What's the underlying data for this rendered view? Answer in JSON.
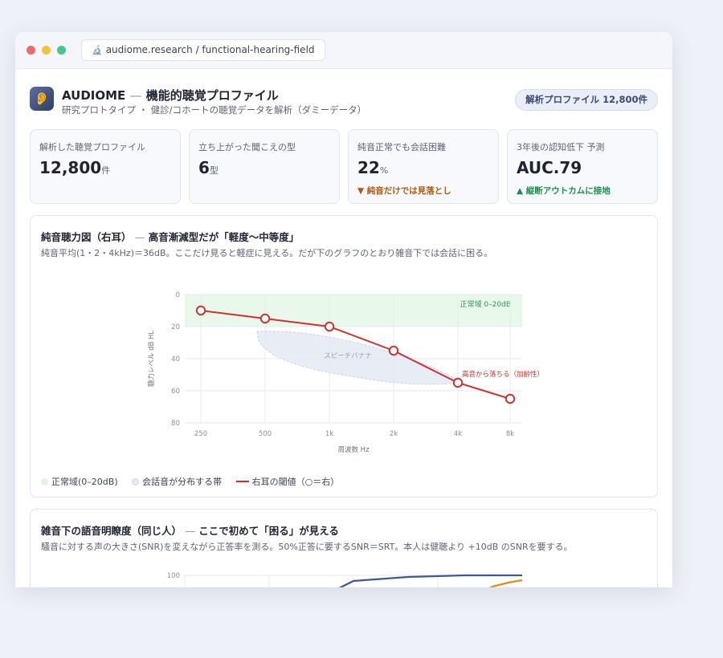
{
  "browser": {
    "url": "audiome.research / functional-hearing-field",
    "url_icon": "microscope-icon"
  },
  "app": {
    "logo_icon": "ear-icon",
    "name": "AUDIOME",
    "title_sep": "—",
    "title": "機能的聴覚プロファイル",
    "subtitle": "研究プロトタイプ ・ 健診/コホートの聴覚データを解析（ダミーデータ）",
    "profile_pill": "解析プロファイル 12,800件"
  },
  "kpis": [
    {
      "label": "解析した聴覚プロファイル",
      "value": "12,800",
      "unit": "件",
      "note": "",
      "note_tone": ""
    },
    {
      "label": "立ち上がった聞こえの型",
      "value": "6",
      "unit": "型",
      "note": "",
      "note_tone": ""
    },
    {
      "label": "純音正常でも会話困難",
      "value": "22",
      "unit": "%",
      "note": "▼ 純音だけでは見落とし",
      "note_tone": "warn"
    },
    {
      "label": "3年後の認知低下 予測",
      "value": "AUC.79",
      "unit": "",
      "note": "▲ 縦断アウトカムに接地",
      "note_tone": "good"
    }
  ],
  "panel1": {
    "title_main": "純音聴力図（右耳）",
    "title_sep": "—",
    "title_rest": "高音漸減型だが「軽度〜中等度」",
    "subtitle": "純音平均(1・2・4kHz)＝36dB。ここだけ見ると軽症に見える。だが下のグラフのとおり雑音下では会話に困る。",
    "legend": [
      {
        "label": "正常域(0–20dB)",
        "kind": "dot",
        "color": "#dff6e6"
      },
      {
        "label": "会話音が分布する帯",
        "kind": "dot",
        "color": "#e6eaf3"
      },
      {
        "label": "右耳の閾値（○＝右）",
        "kind": "line",
        "color": "#d0312d"
      }
    ]
  },
  "panel2": {
    "title_main": "雑音下の語音明瞭度（同じ人）",
    "title_sep": "—",
    "title_rest": "ここで初めて「困る」が見える",
    "subtitle": "騒音に対する声の大きさ(SNR)を変えながら正答率を測る。50%正答に要するSNR＝SRT。本人は健聴より +10dB のSNRを要する。"
  },
  "chart_data": [
    {
      "type": "line",
      "title": "",
      "xlabel": "周波数 Hz",
      "ylabel": "聴力レベル dB HL",
      "categories": [
        "250",
        "500",
        "1k",
        "2k",
        "4k",
        "8k"
      ],
      "y_ticks": [
        "0",
        "20",
        "40",
        "60",
        "80"
      ],
      "ylim": [
        0,
        80
      ],
      "y_inverted": true,
      "grid": true,
      "series": [
        {
          "name": "右耳の閾値（○＝右）",
          "values": [
            10,
            15,
            20,
            35,
            55,
            65
          ],
          "color": "#d0312d",
          "marker": "open-circle"
        }
      ],
      "bands": [
        {
          "label": "正常域 0–20dB",
          "from": 0,
          "to": 20,
          "color": "#e8f9ec"
        }
      ],
      "regions": [
        {
          "label": "スピーチバナナ",
          "color": "#e6eaf3"
        }
      ],
      "annotations": [
        {
          "text": "高音から落ちる（加齢性）",
          "category": "4k",
          "value": 55,
          "color": "#c0392b"
        }
      ]
    },
    {
      "type": "line",
      "title": "",
      "y_ticks": [
        "100"
      ],
      "ylim": [
        0,
        100
      ],
      "grid": true,
      "series": [
        {
          "name": "",
          "values_visible": "partial",
          "color": "#3c5a8c"
        },
        {
          "name": "",
          "values_visible": "partial",
          "color": "#e08a1a"
        }
      ]
    }
  ]
}
